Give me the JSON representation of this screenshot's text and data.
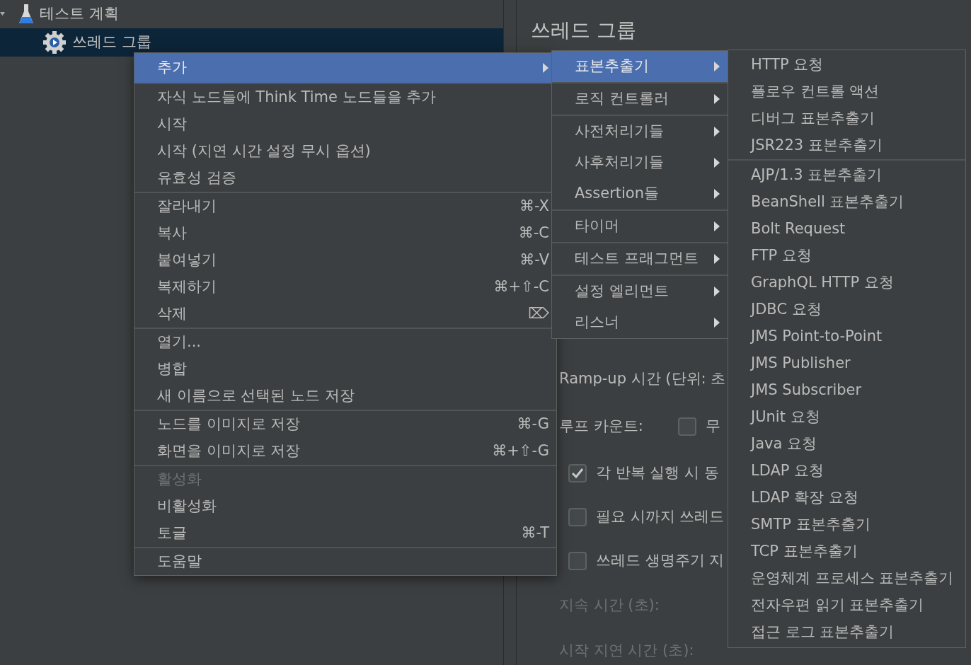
{
  "tree": [
    {
      "label": "테스트 계획",
      "selected": false,
      "expanded": true
    },
    {
      "label": "쓰레드 그룹",
      "selected": true
    }
  ],
  "panel": {
    "title": "쓰레드 그룹",
    "form": [
      {
        "kind": "label",
        "text": "Ramp-up 시간 (단위: 초",
        "disabled": false
      },
      {
        "kind": "loop",
        "text": "루프 카운트:",
        "checked": false,
        "option": "무"
      },
      {
        "kind": "checkbox",
        "text": "각 반복 실행 시 동",
        "checked": true
      },
      {
        "kind": "checkbox",
        "text": "필요 시까지 쓰레드",
        "checked": false
      },
      {
        "kind": "checkbox",
        "text": "쓰레드 생명주기 지",
        "checked": false
      },
      {
        "kind": "label",
        "text": "지속 시간 (초):",
        "disabled": true
      },
      {
        "kind": "label",
        "text": "시작 지연 시간 (초):",
        "disabled": true
      }
    ]
  },
  "context_menu": [
    [
      {
        "label": "추가",
        "submenu": true,
        "selected": true,
        "disabled": false
      }
    ],
    [
      {
        "label": "자식 노드들에 Think Time 노드들을 추가",
        "selected": false,
        "disabled": false
      },
      {
        "label": "시작",
        "selected": false,
        "disabled": false
      },
      {
        "label": "시작 (지연 시간 설정 무시 옵션)",
        "selected": false,
        "disabled": false
      },
      {
        "label": "유효성 검증",
        "selected": false,
        "disabled": false
      }
    ],
    [
      {
        "label": "잘라내기",
        "shortcut": "⌘-X",
        "selected": false,
        "disabled": false
      },
      {
        "label": "복사",
        "shortcut": "⌘-C",
        "selected": false,
        "disabled": false
      },
      {
        "label": "붙여넣기",
        "shortcut": "⌘-V",
        "selected": false,
        "disabled": false
      },
      {
        "label": "복제하기",
        "shortcut": "⌘+⇧-C",
        "selected": false,
        "disabled": false
      },
      {
        "label": "삭제",
        "shortcut": "⌦",
        "selected": false,
        "disabled": false
      }
    ],
    [
      {
        "label": "열기...",
        "selected": false,
        "disabled": false
      },
      {
        "label": "병합",
        "selected": false,
        "disabled": false
      },
      {
        "label": "새 이름으로 선택된 노드 저장",
        "selected": false,
        "disabled": false
      }
    ],
    [
      {
        "label": "노드를 이미지로 저장",
        "shortcut": "⌘-G",
        "selected": false,
        "disabled": false
      },
      {
        "label": "화면을 이미지로 저장",
        "shortcut": "⌘+⇧-G",
        "selected": false,
        "disabled": false
      }
    ],
    [
      {
        "label": "활성화",
        "selected": false,
        "disabled": true
      },
      {
        "label": "비활성화",
        "selected": false,
        "disabled": false
      },
      {
        "label": "토글",
        "shortcut": "⌘-T",
        "selected": false,
        "disabled": false
      }
    ],
    [
      {
        "label": "도움말",
        "selected": false,
        "disabled": false
      }
    ]
  ],
  "add_submenu": [
    [
      {
        "label": "표본추출기",
        "submenu": true,
        "selected": true
      }
    ],
    [
      {
        "label": "로직 컨트롤러",
        "submenu": true,
        "selected": false
      }
    ],
    [
      {
        "label": "사전처리기들",
        "submenu": true,
        "selected": false
      },
      {
        "label": "사후처리기들",
        "submenu": true,
        "selected": false
      },
      {
        "label": "Assertion들",
        "submenu": true,
        "selected": false
      }
    ],
    [
      {
        "label": "타이머",
        "submenu": true,
        "selected": false
      }
    ],
    [
      {
        "label": "테스트 프래그먼트",
        "submenu": true,
        "selected": false
      }
    ],
    [
      {
        "label": "설정 엘리먼트",
        "submenu": true,
        "selected": false
      },
      {
        "label": "리스너",
        "submenu": true,
        "selected": false
      }
    ]
  ],
  "sampler_submenu": [
    [
      "HTTP 요청",
      "플로우 컨트롤 액션",
      "디버그 표본추출기",
      "JSR223 표본추출기"
    ],
    [
      "AJP/1.3 표본추출기",
      "BeanShell 표본추출기",
      "Bolt Request",
      "FTP 요청",
      "GraphQL HTTP 요청",
      "JDBC 요청",
      "JMS Point-to-Point",
      "JMS Publisher",
      "JMS Subscriber",
      "JUnit 요청",
      "Java 요청",
      "LDAP 요청",
      "LDAP 확장 요청",
      "SMTP 표본추출기",
      "TCP 표본추출기",
      "운영체계 프로세스 표본추출기",
      "전자우편 읽기 표본추출기",
      "접근 로그 표본추출기"
    ]
  ]
}
